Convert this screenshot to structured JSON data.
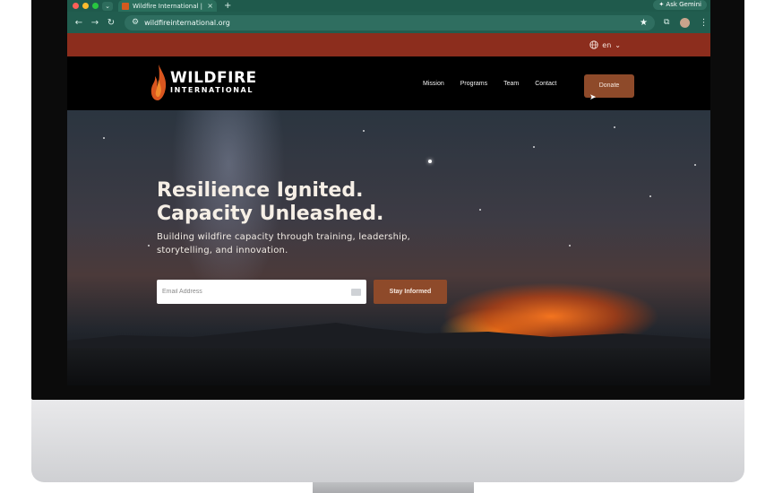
{
  "browser": {
    "tab_title": "Wildfire International | Global",
    "url": "wildfireinternational.org",
    "gemini_label": "Ask Gemini",
    "traffic_colors": [
      "#ff5f57",
      "#febc2e",
      "#28c840"
    ]
  },
  "site": {
    "language": "en",
    "logo_main": "WILDFIRE",
    "logo_sub": "INTERNATIONAL",
    "nav": [
      "Mission",
      "Programs",
      "Team",
      "Contact"
    ],
    "donate_label": "Donate",
    "accent_color": "#8e4a2a",
    "strip_color": "#8c2d1d"
  },
  "hero": {
    "headline_line1": "Resilience Ignited.",
    "headline_line2": "Capacity Unleashed.",
    "subheading": "Building wildfire capacity through training, leadership, storytelling, and innovation.",
    "email_placeholder": "Email Address",
    "cta_label": "Stay Informed"
  }
}
